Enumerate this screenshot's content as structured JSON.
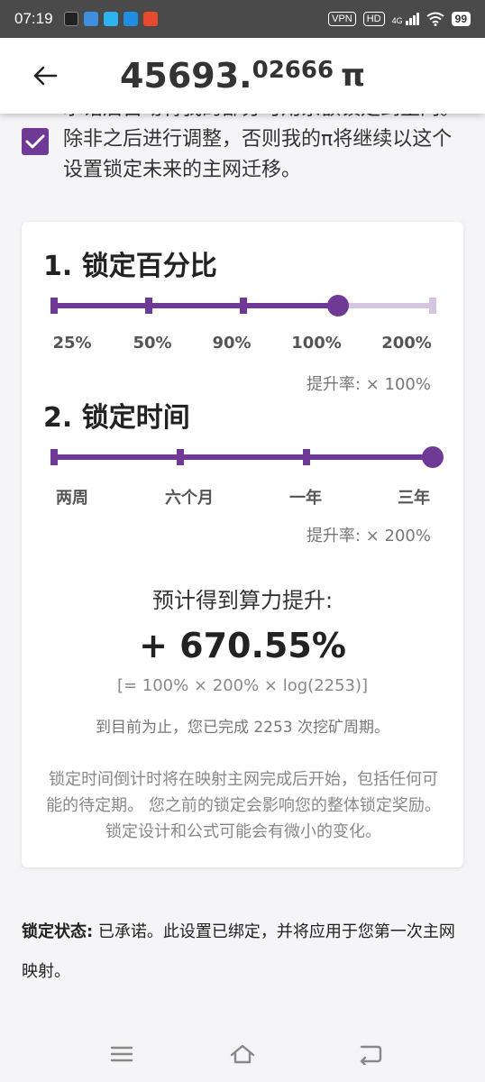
{
  "status_bar": {
    "time": "07:19",
    "vpn": "VPN",
    "hd": "HD",
    "network": "4G",
    "battery": "99"
  },
  "header": {
    "balance_int": "45693.",
    "balance_frac": "02666",
    "unit": "π"
  },
  "agree": {
    "checked": true,
    "text": "承诺后自动将我的部分可用余额锁定到主网。除非之后进行调整，否则我的π将继续以这个设置锁定未来的主网迁移。"
  },
  "lock_percent": {
    "title": "1. 锁定百分比",
    "options": [
      "25%",
      "50%",
      "90%",
      "100%",
      "200%"
    ],
    "selected_index": 3,
    "rate": "提升率: × 100%"
  },
  "lock_time": {
    "title": "2. 锁定时间",
    "options": [
      "两周",
      "六个月",
      "一年",
      "三年"
    ],
    "selected_index": 3,
    "rate": "提升率: × 200%"
  },
  "estimate": {
    "label": "预计得到算力提升:",
    "value": "+ 670.55%",
    "formula": "[= 100% × 200% × log(2253)]",
    "cycles": "到目前为止，您已完成 2253 次挖矿周期。"
  },
  "note": "锁定时间倒计时将在映射主网完成后开始，包括任何可能的待定期。 您之前的锁定会影响您的整体锁定奖励。锁定设计和公式可能会有微小的变化。",
  "lock_status": {
    "label": "锁定状态:",
    "text": " 已承诺。此设置已绑定，并将应用于您第一次主网映射。"
  },
  "colors": {
    "accent": "#6e3a96",
    "accent_light": "#d5c5e0"
  }
}
